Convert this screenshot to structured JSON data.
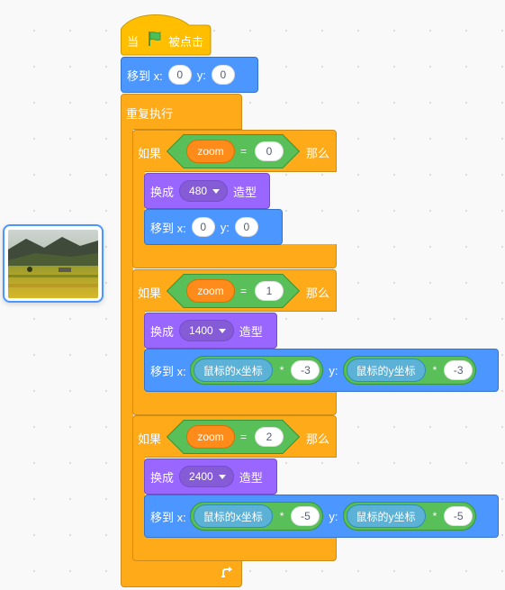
{
  "hat": {
    "label_when": "当",
    "label_clicked": "被点击",
    "flag_icon": "green-flag-icon"
  },
  "goto_start": {
    "label": "移到 x:",
    "x": "0",
    "y_label": "y:",
    "y": "0"
  },
  "forever": {
    "label": "重复执行",
    "loop_icon": "repeat-arrow-icon"
  },
  "if_blocks": [
    {
      "if_label": "如果",
      "then_label": "那么",
      "var": "zoom",
      "op": "=",
      "value": "1",
      "costume_label": "换成",
      "costume": "1400",
      "costume_suffix": "造型",
      "goto_label": "移到 x:",
      "mx_reporter": "鼠标的x坐标",
      "mult": "*",
      "mx_factor": "-3",
      "y_label": "y:",
      "my_reporter": "鼠标的y坐标",
      "my_factor": "-3"
    },
    {
      "if_label": "如果",
      "then_label": "那么",
      "var": "zoom",
      "op": "=",
      "value": "2",
      "costume_label": "换成",
      "costume": "2400",
      "costume_suffix": "造型",
      "goto_label": "移到 x:",
      "mx_reporter": "鼠标的x坐标",
      "mult": "*",
      "mx_factor": "-5",
      "y_label": "y:",
      "my_reporter": "鼠标的y坐标",
      "my_factor": "-5"
    }
  ],
  "if0": {
    "if_label": "如果",
    "then_label": "那么",
    "var": "zoom",
    "op": "=",
    "value": "0",
    "costume_label": "换成",
    "costume": "480",
    "costume_suffix": "造型",
    "goto_label": "移到 x:",
    "x": "0",
    "y_label": "y:",
    "y": "0"
  },
  "colors": {
    "events": "#ffbf00",
    "motion": "#4c97ff",
    "looks": "#9966ff",
    "control": "#ffab19",
    "operators": "#59c059",
    "variables": "#ff8c1a",
    "sensing": "#5cb1d6"
  }
}
